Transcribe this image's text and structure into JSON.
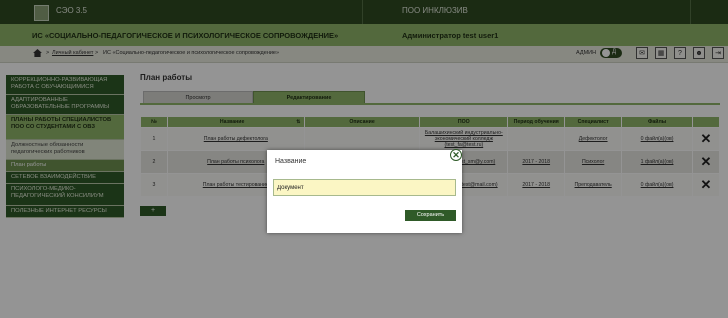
{
  "topbar": {
    "version": "СЭО 3.5",
    "poo_label": "ПОО ИНКЛЮЗИВ"
  },
  "header": {
    "system_title": "ИС «СОЦИАЛЬНО-ПЕДАГОГИЧЕСКОЕ И ПСИХОЛОГИЧЕСКОЕ СОПРОВОЖДЕНИЕ»",
    "user": "Администратор test user1"
  },
  "breadcrumb": {
    "items": [
      "Личный кабинет",
      "ИС «Социально-педагогическое и психологическое сопровождение»"
    ],
    "separator": ">"
  },
  "toolbar": {
    "admin_label": "АДМИН",
    "toggle_label": "Д",
    "icons": [
      "mail-icon",
      "calendar-icon",
      "help-icon",
      "user-icon",
      "exit-icon"
    ],
    "glyphs": [
      "✉",
      "▦",
      "?",
      "☻",
      "⇥"
    ]
  },
  "sidebar": {
    "items": [
      {
        "label": "КОРРЕКЦИОННО-РАЗВИВАЮЩАЯ РАБОТА С ОБУЧАЮЩИМИСЯ",
        "kind": "main"
      },
      {
        "label": "АДАПТИРОВАННЫЕ ОБРАЗОВАТЕЛЬНЫЕ ПРОГРАММЫ",
        "kind": "main"
      },
      {
        "label": "ПЛАНЫ РАБОТЫ СПЕЦИАЛИСТОВ ПОО СО СТУДЕНТАМИ С ОВЗ",
        "kind": "active"
      },
      {
        "label": "Должностные обязанности педагогических работников",
        "kind": "sub"
      },
      {
        "label": "План работы",
        "kind": "subsel"
      },
      {
        "label": "СЕТЕВОЕ ВЗАИМОДЕЙСТВИЕ",
        "kind": "main"
      },
      {
        "label": "ПСИХОЛОГО-МЕДИКО-ПЕДАГОГИЧЕСКИЙ КОНСИЛИУМ",
        "kind": "main"
      },
      {
        "label": "ПОЛЕЗНЫЕ ИНТЕРНЕТ РЕСУРСЫ",
        "kind": "main"
      }
    ]
  },
  "page": {
    "title": "План работы",
    "tabs": [
      "Просмотр",
      "Редактирование"
    ],
    "active_tab": 1
  },
  "table": {
    "headers": [
      "№",
      "Название",
      "Описание",
      "ПОО",
      "Период обучения",
      "Специалист",
      "Файлы"
    ],
    "sort_icon": "⇅",
    "rows": [
      {
        "num": "1",
        "name": "План работы дефектолога",
        "description": "",
        "poo": "Балашихинский индустриально-экономический колледж (test_fa@test.ru)",
        "period": "",
        "specialist": "Дефектолог",
        "files": "0 файл(а)(ов)"
      },
      {
        "num": "2",
        "name": "План работы психолога",
        "description": "",
        "poo": "Колледж (test_sm@y.com)",
        "period": "2017 - 2018",
        "specialist": "Психолог",
        "files": "1 файл(а)(ов)"
      },
      {
        "num": "3",
        "name": "План работы тестирование",
        "description": "",
        "poo": "Колледж 07 (test@mail.com)",
        "period": "2017 - 2018",
        "specialist": "Преподаватель",
        "files": "0 файл(а)(ов)"
      }
    ],
    "delete_glyph": "✕"
  },
  "add_button": "+",
  "modal": {
    "title": "Название",
    "input_value": "Документ",
    "save_label": "Сохранить",
    "close_glyph": "✕"
  },
  "colors": {
    "dark_green": "#2f4a22",
    "accent_green": "#8fb56a",
    "input_yellow": "#fbf6c4"
  }
}
